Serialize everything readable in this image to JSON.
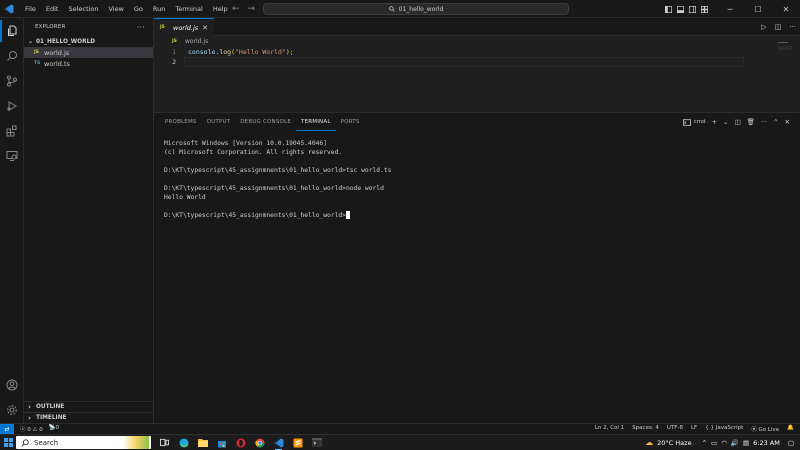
{
  "titlebar": {
    "menu": [
      "File",
      "Edit",
      "Selection",
      "View",
      "Go",
      "Run",
      "Terminal",
      "Help"
    ],
    "search_text": "01_hello_world"
  },
  "explorer": {
    "header": "EXPLORER",
    "folder": "01_HELLO_WORLD",
    "files": [
      {
        "badge": "JS",
        "name": "world.js",
        "selected": true
      },
      {
        "badge": "TS",
        "name": "world.ts",
        "selected": false
      }
    ],
    "outline": "OUTLINE",
    "timeline": "TIMELINE"
  },
  "editor": {
    "tab": {
      "badge": "JS",
      "name": "world.js"
    },
    "breadcrumb": "world.js",
    "lines": [
      {
        "num": "1"
      },
      {
        "num": "2"
      }
    ],
    "code_line1": {
      "obj": "console",
      "dot": ".",
      "fn": "log",
      "open": "(",
      "str": "\"Hello World\"",
      "close": ")",
      "semi": ";"
    }
  },
  "panel": {
    "tabs": [
      "PROBLEMS",
      "OUTPUT",
      "DEBUG CONSOLE",
      "TERMINAL",
      "PORTS"
    ],
    "active_tab": "TERMINAL",
    "shell": "cmd",
    "terminal_lines": [
      "Microsoft Windows [Version 10.0.19045.4046]",
      "(c) Microsoft Corporation. All rights reserved.",
      "",
      "D:\\KT\\typescript\\45_assignmnents\\01_hello_world>tsc world.ts",
      "",
      "D:\\KT\\typescript\\45_assignmnents\\01_hello_world>node world",
      "Hello World",
      "",
      "D:\\KT\\typescript\\45_assignmnents\\01_hello_world>"
    ]
  },
  "statusbar": {
    "errors": "0",
    "warnings": "0",
    "ports": "0",
    "position": "Ln 2, Col 1",
    "spaces": "Spaces: 4",
    "encoding": "UTF-8",
    "eol": "LF",
    "language": "JavaScript",
    "golive": "Go Live"
  },
  "taskbar": {
    "search": "Search",
    "weather": "20°C  Haze",
    "time": "6:23 AM"
  },
  "colors": {
    "accent": "#0078d4",
    "background": "#1f1f1f",
    "sidebar": "#181818"
  }
}
